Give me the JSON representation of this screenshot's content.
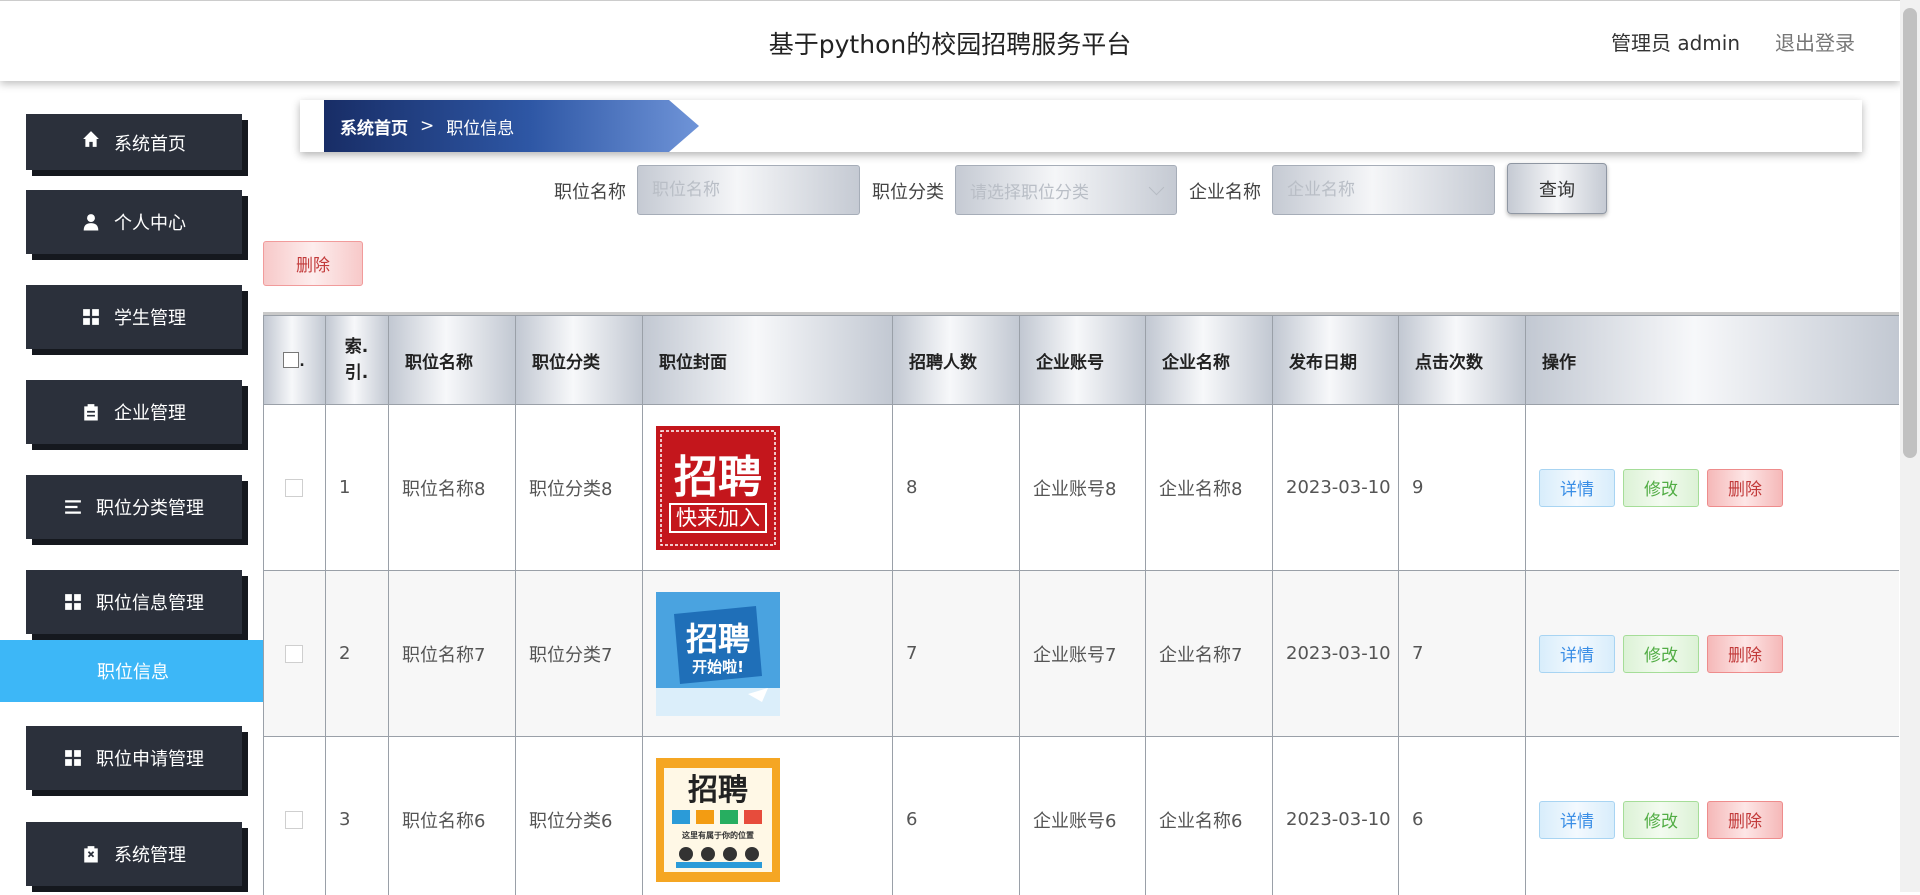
{
  "header": {
    "title": "基于python的校园招聘服务平台",
    "admin_label": "管理员 admin",
    "logout": "退出登录"
  },
  "sidebar": {
    "items": [
      {
        "label": "系统首页",
        "icon": "home-icon"
      },
      {
        "label": "个人中心",
        "icon": "user-icon"
      },
      {
        "label": "学生管理",
        "icon": "grid-icon"
      },
      {
        "label": "企业管理",
        "icon": "clipboard-icon"
      },
      {
        "label": "职位分类管理",
        "icon": "list-icon"
      },
      {
        "label": "职位信息管理",
        "icon": "grid-icon"
      },
      {
        "label": "职位申请管理",
        "icon": "grid-icon"
      },
      {
        "label": "系统管理",
        "icon": "clipboard-x-icon"
      }
    ],
    "active_submenu": "职位信息"
  },
  "breadcrumb": {
    "home": "系统首页",
    "separator": ">",
    "current": "职位信息"
  },
  "search": {
    "job_name_label": "职位名称",
    "job_name_placeholder": "职位名称",
    "job_category_label": "职位分类",
    "job_category_placeholder": "请选择职位分类",
    "company_name_label": "企业名称",
    "company_name_placeholder": "企业名称",
    "query_button": "查询"
  },
  "batch_delete_button": "删除",
  "table": {
    "header_check_mark": ".",
    "index_header_line1": "索.",
    "index_header_line2": "引.",
    "columns": [
      "职位名称",
      "职位分类",
      "职位封面",
      "招聘人数",
      "企业账号",
      "企业名称",
      "发布日期",
      "点击次数",
      "操作"
    ],
    "rows": [
      {
        "index": "1",
        "job_name": "职位名称8",
        "category": "职位分类8",
        "cover": {
          "type": "red-poster",
          "line1": "招聘",
          "line2": "快来加入"
        },
        "headcount": "8",
        "account": "企业账号8",
        "company": "企业名称8",
        "date": "2023-03-10",
        "clicks": "9"
      },
      {
        "index": "2",
        "job_name": "职位名称7",
        "category": "职位分类7",
        "cover": {
          "type": "blue-poster",
          "line1": "招聘",
          "line2": "开始啦!"
        },
        "headcount": "7",
        "account": "企业账号7",
        "company": "企业名称7",
        "date": "2023-03-10",
        "clicks": "7"
      },
      {
        "index": "3",
        "job_name": "职位名称6",
        "category": "职位分类6",
        "cover": {
          "type": "yellow-poster",
          "line1": "招聘",
          "line2": "这里有属于你的位置"
        },
        "headcount": "6",
        "account": "企业账号6",
        "company": "企业名称6",
        "date": "2023-03-10",
        "clicks": "6"
      }
    ],
    "actions": {
      "detail": "详情",
      "edit": "修改",
      "delete": "删除"
    }
  },
  "colors": {
    "sidebar_bg": "#2b303b",
    "sidebar_active": "#3db7f7",
    "breadcrumb_start": "#182d66",
    "breadcrumb_end": "#6f94d8"
  }
}
